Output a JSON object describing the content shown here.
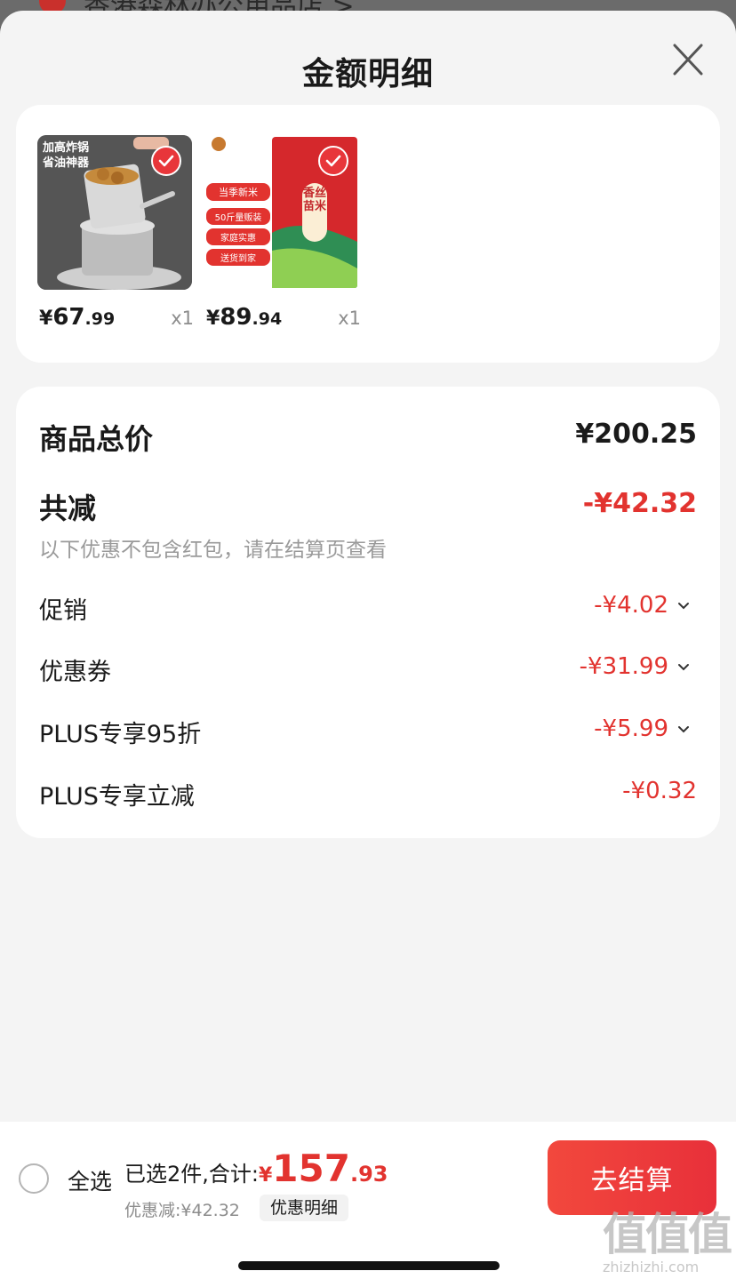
{
  "background": {
    "store_name_partial": "香港森林办公用品店 >"
  },
  "sheet": {
    "title": "金额明细",
    "close_icon": "close-icon"
  },
  "products": [
    {
      "image_text_line1": "加高炸锅",
      "image_text_line2": "省油神器",
      "price_yen": "¥",
      "price_int": "67",
      "price_dec": ".99",
      "qty": "x1"
    },
    {
      "image_badges": [
        "当季新米",
        "50斤量贩装",
        "家庭实惠",
        "送货到家"
      ],
      "bag_text": "香丝苗米",
      "price_yen": "¥",
      "price_int": "89",
      "price_dec": ".94",
      "qty": "x1"
    }
  ],
  "summary": {
    "total_label": "商品总价",
    "total_value": "¥200.25",
    "reduce_label": "共减",
    "reduce_value": "-¥42.32",
    "reduce_note": "以下优惠不包含红包，请在结算页查看",
    "items": [
      {
        "label": "促销",
        "value": "-¥4.02",
        "expandable": true
      },
      {
        "label": "优惠券",
        "value": "-¥31.99",
        "expandable": true
      },
      {
        "label": "PLUS专享95折",
        "value": "-¥5.99",
        "expandable": true
      },
      {
        "label": "PLUS专享立减",
        "value": "-¥0.32",
        "expandable": false
      }
    ]
  },
  "footer": {
    "select_all_label": "全选",
    "selected_text": "已选2件,合计:",
    "total_yen": "¥",
    "total_int": "157",
    "total_dec": ".93",
    "discount_text": "优惠减:¥42.32",
    "detail_label": "优惠明细",
    "checkout_label": "去结算"
  },
  "watermark": {
    "glyphs": "值值值",
    "text": "zhizhizhi.com"
  },
  "colors": {
    "accent_red": "#e2332f",
    "checkout_red": "#ec3a3a",
    "sheet_bg": "#f4f4f4"
  }
}
